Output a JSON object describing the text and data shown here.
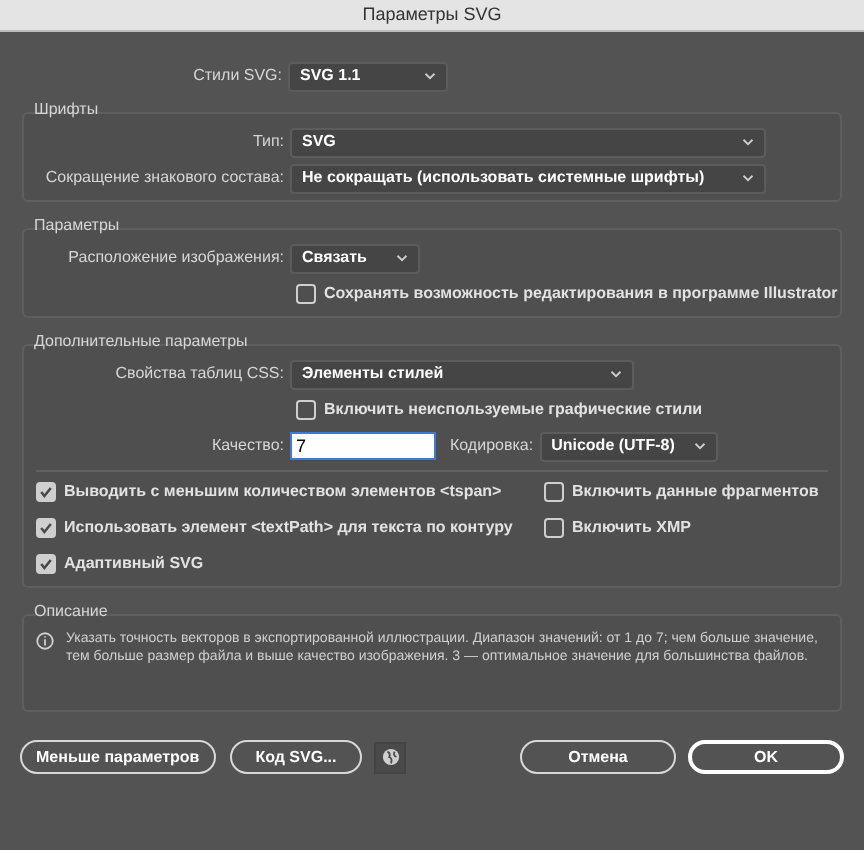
{
  "window": {
    "title": "Параметры SVG"
  },
  "svg_styles": {
    "label": "Стили SVG:",
    "value": "SVG 1.1"
  },
  "fonts": {
    "title": "Шрифты",
    "type": {
      "label": "Тип:",
      "value": "SVG"
    },
    "subsetting": {
      "label": "Сокращение знакового состава:",
      "value": "Не сокращать (использовать системные шрифты)"
    }
  },
  "options": {
    "title": "Параметры",
    "image_location": {
      "label": "Расположение изображения:",
      "value": "Связать"
    },
    "preserve_editing": {
      "label": "Сохранять возможность редактирования в программе Illustrator",
      "checked": false
    }
  },
  "advanced": {
    "title": "Дополнительные параметры",
    "css_properties": {
      "label": "Свойства таблиц CSS:",
      "value": "Элементы стилей"
    },
    "include_unused": {
      "label": "Включить неиспользуемые графические стили",
      "checked": false
    },
    "quality": {
      "label": "Качество:",
      "value": "7"
    },
    "encoding": {
      "label": "Кодировка:",
      "value": "Unicode (UTF-8)"
    },
    "left_checks": [
      {
        "label": "Выводить с меньшим количеством элементов <tspan>",
        "checked": true
      },
      {
        "label": "Использовать элемент <textPath> для текста по контуру",
        "checked": true
      },
      {
        "label": "Адаптивный SVG",
        "checked": true
      }
    ],
    "right_checks": [
      {
        "label": "Включить данные фрагментов",
        "checked": false
      },
      {
        "label": "Включить XMP",
        "checked": false
      }
    ]
  },
  "description": {
    "title": "Описание",
    "text": "Указать точность векторов в экспортированной иллюстрации. Диапазон значений: от 1 до 7; чем больше значение, тем больше размер файла и выше качество изображения. 3 — оптимальное значение для большинства файлов."
  },
  "buttons": {
    "less_options": "Меньше параметров",
    "svg_code": "Код SVG...",
    "cancel": "Отмена",
    "ok": "OK"
  }
}
